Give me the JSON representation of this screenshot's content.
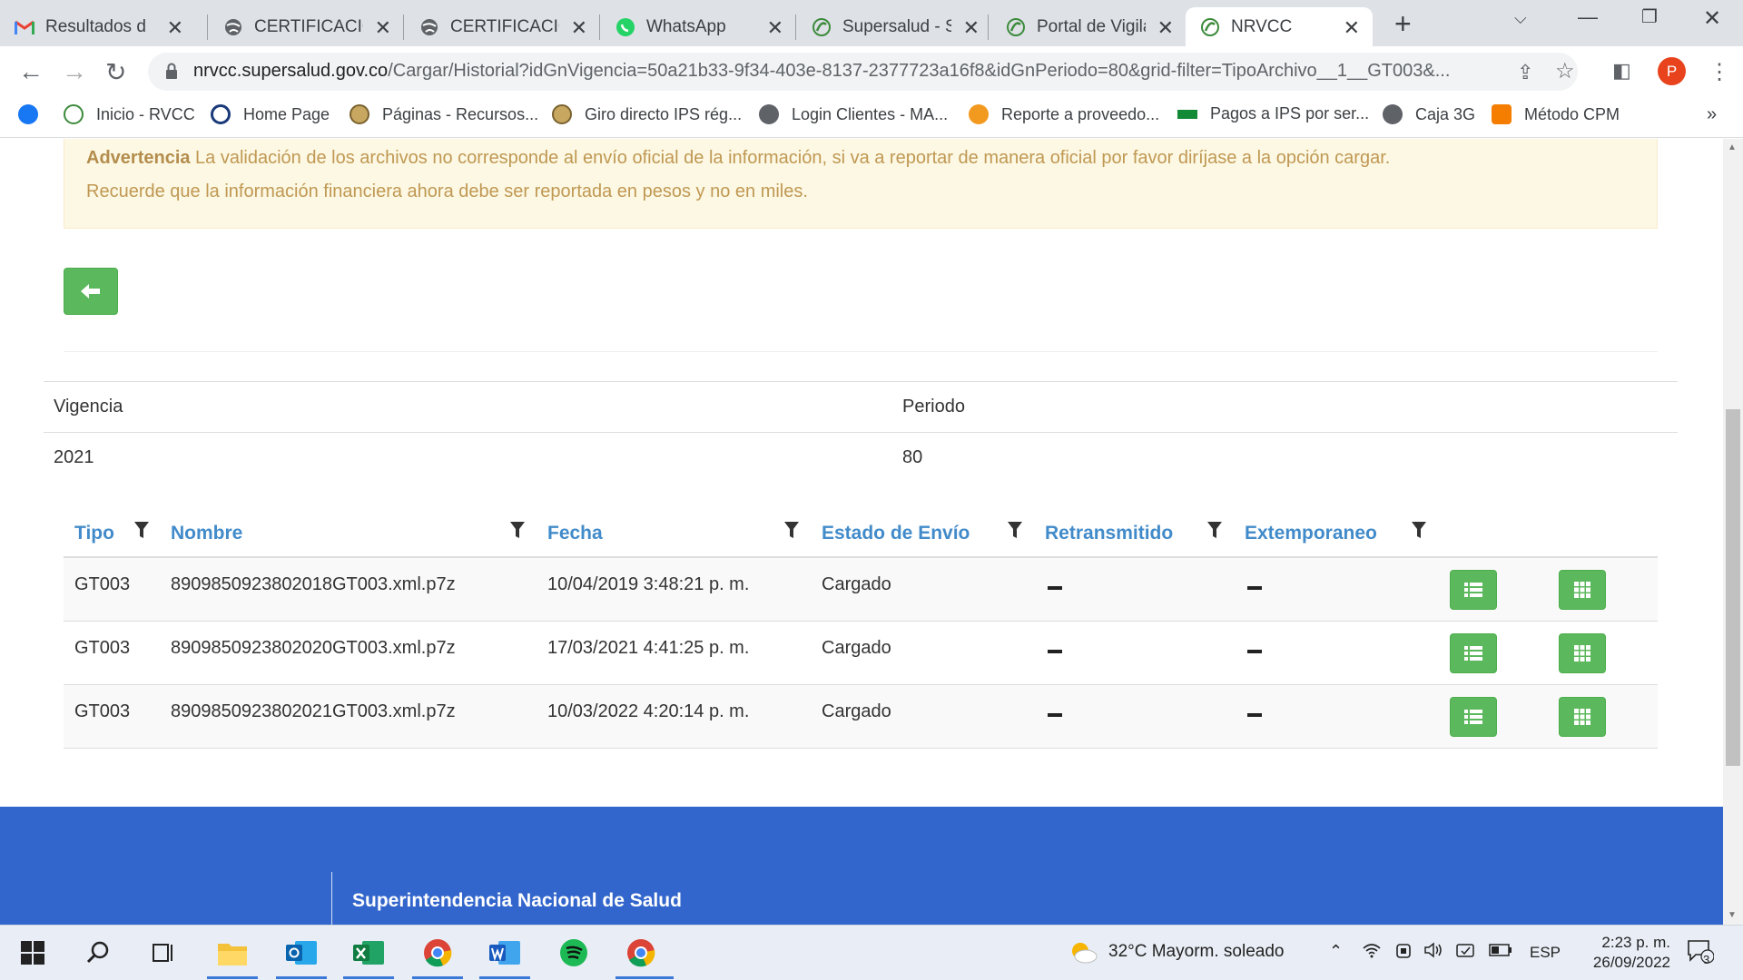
{
  "browser": {
    "tabs": [
      {
        "title": "Resultados de la búsqueda",
        "icon": "gmail-icon"
      },
      {
        "title": "CERTIFICACION",
        "icon": "globe-icon"
      },
      {
        "title": "CERTIFICACION",
        "icon": "globe-icon"
      },
      {
        "title": "WhatsApp",
        "icon": "whatsapp-icon"
      },
      {
        "title": "Supersalud - Si",
        "icon": "supersalud-icon"
      },
      {
        "title": "Portal de Vigila",
        "icon": "supersalud-icon"
      },
      {
        "title": "NRVCC",
        "icon": "supersalud-icon",
        "active": true
      }
    ],
    "url_host": "nrvcc.supersalud.gov.co",
    "url_rest": "/Cargar/Historial?idGnVigencia=50a21b33-9f34-403e-8137-2377723a16f8&idGnPeriodo=80&grid-filter=TipoArchivo__1__GT003&...",
    "profile_initial": "P",
    "bookmarks": [
      {
        "label": "",
        "icon": "facebook-icon"
      },
      {
        "label": "Inicio - RVCC",
        "icon": "supersalud-icon"
      },
      {
        "label": "Home Page",
        "icon": "home-page-icon"
      },
      {
        "label": "Páginas - Recursos...",
        "icon": "seal-icon"
      },
      {
        "label": "Giro directo IPS rég...",
        "icon": "seal-icon"
      },
      {
        "label": "Login Clientes - MA...",
        "icon": "globe-icon"
      },
      {
        "label": "Reporte a proveedo...",
        "icon": "orange-circle-icon"
      },
      {
        "label": "Pagos a IPS por ser...",
        "icon": "flag-icon"
      },
      {
        "label": "Caja 3G",
        "icon": "globe-icon"
      },
      {
        "label": "Método CPM",
        "icon": "blogger-icon"
      }
    ]
  },
  "alert": {
    "strong": "Advertencia",
    "text": " La validación de los archivos no corresponde al envío oficial de la información, si va a reportar de manera oficial por favor diríjase a la opción cargar.",
    "line2": "Recuerde que la información financiera ahora debe ser reportada en pesos y no en miles."
  },
  "info": {
    "headers": [
      "Vigencia",
      "Periodo"
    ],
    "values": [
      "2021",
      "80"
    ]
  },
  "grid": {
    "columns": [
      "Tipo",
      "Nombre",
      "Fecha",
      "Estado de Envío",
      "Retransmitido",
      "Extemporaneo"
    ],
    "rows": [
      {
        "tipo": "GT003",
        "nombre": "8909850923802018GT003.xml.p7z",
        "fecha": "10/04/2019 3:48:21 p. m.",
        "estado": "Cargado"
      },
      {
        "tipo": "GT003",
        "nombre": "8909850923802020GT003.xml.p7z",
        "fecha": "17/03/2021 4:41:25 p. m.",
        "estado": "Cargado"
      },
      {
        "tipo": "GT003",
        "nombre": "8909850923802021GT003.xml.p7z",
        "fecha": "10/03/2022 4:20:14 p. m.",
        "estado": "Cargado"
      }
    ]
  },
  "footer": {
    "org": "Superintendencia Nacional de Salud"
  },
  "taskbar": {
    "weather": "32°C  Mayorm. soleado",
    "lang": "ESP",
    "time": "2:23 p. m.",
    "date": "26/09/2022",
    "notifications": "3"
  },
  "colors": {
    "accent_blue": "#428bca",
    "success_green": "#5cb85c",
    "footer_blue": "#3366cc",
    "alert_bg": "#fcf8e3"
  }
}
